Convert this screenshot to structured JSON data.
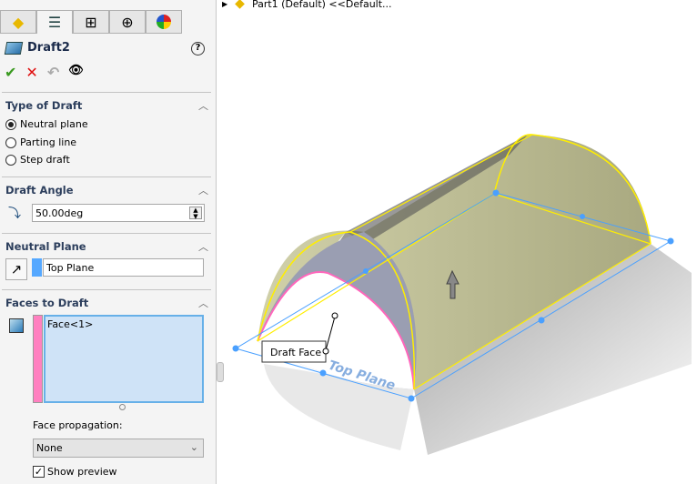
{
  "tabs": [
    {
      "icon": "feature-manager-icon"
    },
    {
      "icon": "property-manager-icon"
    },
    {
      "icon": "configuration-manager-icon"
    },
    {
      "icon": "dimxpert-icon"
    },
    {
      "icon": "display-manager-icon"
    }
  ],
  "feature": {
    "title": "Draft2",
    "help": "?",
    "ok": "✔",
    "cancel": "✕",
    "undo": "↶",
    "preview": "👁"
  },
  "type_of_draft": {
    "title": "Type of Draft",
    "options": [
      "Neutral plane",
      "Parting line",
      "Step draft"
    ],
    "selected": "Neutral plane"
  },
  "draft_angle": {
    "title": "Draft Angle",
    "value": "50.00deg"
  },
  "neutral_plane": {
    "title": "Neutral Plane",
    "value": "Top Plane",
    "color": "#55a8ff"
  },
  "faces_to_draft": {
    "title": "Faces to Draft",
    "items": [
      "Face<1>"
    ],
    "color": "#ff80c0",
    "propagation_label": "Face propagation:",
    "propagation": "None",
    "show_preview_label": "Show preview",
    "show_preview": true
  },
  "tree": {
    "item": "Part1 (Default) <<Default..."
  },
  "viewport": {
    "callout": "Draft Face",
    "plane_label": "Top Plane"
  }
}
